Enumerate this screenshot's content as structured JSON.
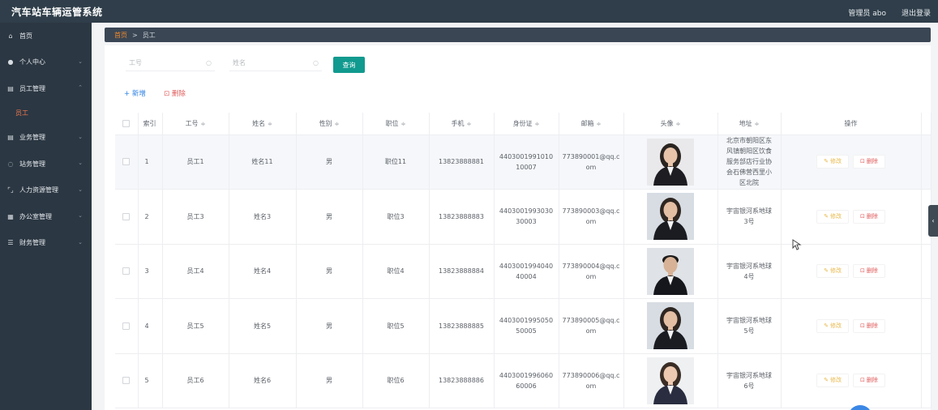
{
  "header": {
    "title": "汽车站车辆运管系统",
    "admin": "管理员 abo",
    "logout": "退出登录"
  },
  "sidebar": {
    "items": [
      {
        "label": "首页",
        "icon": "home-icon",
        "glyph": "⌂",
        "chevron": ""
      },
      {
        "label": "个人中心",
        "icon": "user-icon",
        "glyph": "●",
        "chevron": "⌄"
      },
      {
        "label": "员工管理",
        "icon": "document-icon",
        "glyph": "▤",
        "chevron": "⌃"
      },
      {
        "label": "员工",
        "sub": true
      },
      {
        "label": "业务管理",
        "icon": "document-icon",
        "glyph": "▤",
        "chevron": "⌄"
      },
      {
        "label": "站务管理",
        "icon": "clock-icon",
        "glyph": "◌",
        "chevron": "⌄"
      },
      {
        "label": "人力资源管理",
        "icon": "bracket-icon",
        "glyph": "⌜⌟",
        "chevron": "⌄"
      },
      {
        "label": "办公室管理",
        "icon": "grid-icon",
        "glyph": "▦",
        "chevron": "⌄"
      },
      {
        "label": "财务管理",
        "icon": "sliders-icon",
        "glyph": "☰",
        "chevron": "⌄"
      }
    ]
  },
  "breadcrumb": {
    "home": "首页",
    "sep": ">",
    "current": "员工"
  },
  "search": {
    "id_placeholder": "工号",
    "name_placeholder": "姓名",
    "button": "查询"
  },
  "actions": {
    "add": "+ 新增",
    "delete": "⊡ 删除"
  },
  "table": {
    "headers": [
      "索引",
      "工号",
      "姓名",
      "性别",
      "职位",
      "手机",
      "身份证",
      "邮箱",
      "头像",
      "地址",
      "操作"
    ],
    "sort_icon": "≑",
    "rows": [
      {
        "index": "1",
        "id": "员工1",
        "name": "姓名11",
        "gender": "男",
        "position": "职位11",
        "phone": "13823888881",
        "idcard": "440300199101010007",
        "email": "773890001@qq.com",
        "address": "北京市朝阳区东风镇朝阳区饮食服务部店行业协会石佛营西里小区北院",
        "avatar": "female",
        "highlighted": true
      },
      {
        "index": "2",
        "id": "员工3",
        "name": "姓名3",
        "gender": "男",
        "position": "职位3",
        "phone": "13823888883",
        "idcard": "440300199303030003",
        "email": "773890003@qq.com",
        "address": "宇宙银河系地球3号",
        "avatar": "female-mic",
        "highlighted": false
      },
      {
        "index": "3",
        "id": "员工4",
        "name": "姓名4",
        "gender": "男",
        "position": "职位4",
        "phone": "13823888884",
        "idcard": "440300199404040004",
        "email": "773890004@qq.com",
        "address": "宇宙银河系地球4号",
        "avatar": "male",
        "highlighted": false
      },
      {
        "index": "4",
        "id": "员工5",
        "name": "姓名5",
        "gender": "男",
        "position": "职位5",
        "phone": "13823888885",
        "idcard": "440300199505050005",
        "email": "773890005@qq.com",
        "address": "宇宙银河系地球5号",
        "avatar": "female-mic",
        "highlighted": false
      },
      {
        "index": "5",
        "id": "员工6",
        "name": "姓名6",
        "gender": "男",
        "position": "职位6",
        "phone": "13823888886",
        "idcard": "440300199606060006",
        "email": "773890006@qq.com",
        "address": "宇宙银河系地球6号",
        "avatar": "female-light",
        "highlighted": false
      }
    ],
    "edit_label": "修改",
    "delete_label": "删除",
    "edit_icon": "✎",
    "delete_icon": "⊡"
  },
  "side_tab_glyph": "‹",
  "colors": {
    "topbar": "#2f3e4a",
    "sidebar": "#2b3743",
    "accent": "#119a8f",
    "active_nav": "#f07a4e",
    "delete": "#e05a5a",
    "edit": "#e8b84a"
  }
}
